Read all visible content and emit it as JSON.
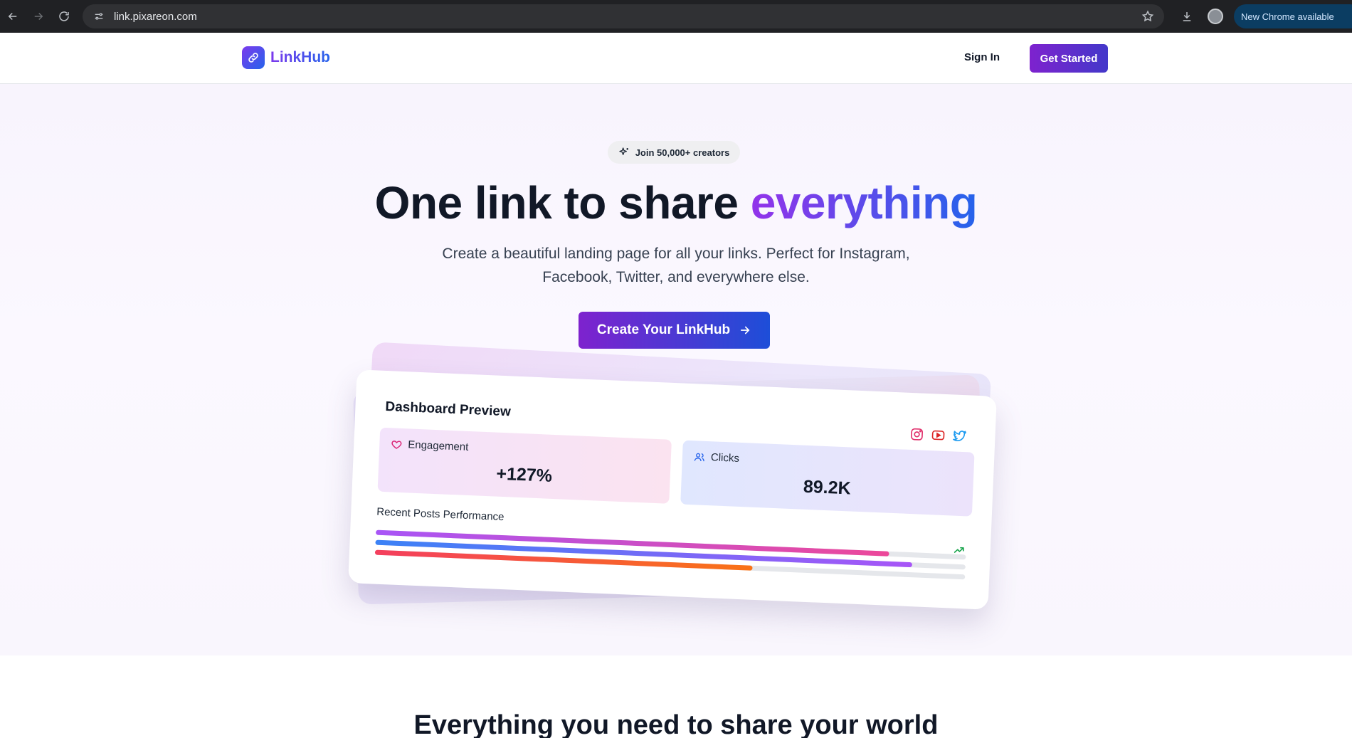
{
  "browser": {
    "url": "link.pixareon.com",
    "update_label": "New Chrome available"
  },
  "header": {
    "brand": "LinkHub",
    "signin_label": "Sign In",
    "get_started_label": "Get Started"
  },
  "hero": {
    "badge_text": "Join 50,000+ creators",
    "headline_main": "One link to share ",
    "headline_accent": "everything",
    "subtext_line1": "Create a beautiful landing page for all your links. Perfect for Instagram,",
    "subtext_line2": "Facebook, Twitter, and everywhere else.",
    "cta_label": "Create Your LinkHub"
  },
  "dashboard": {
    "title": "Dashboard Preview",
    "engagement_label": "Engagement",
    "engagement_value": "+127%",
    "clicks_label": "Clicks",
    "clicks_value": "89.2K",
    "recent_label": "Recent Posts Performance",
    "bars": [
      {
        "fill": 0.87,
        "from": "#a855f7",
        "to": "#ec4899"
      },
      {
        "fill": 0.91,
        "from": "#3b82f6",
        "to": "#a855f7"
      },
      {
        "fill": 0.64,
        "from": "#f43f5e",
        "to": "#f97316"
      }
    ],
    "colors": {
      "instagram": "#e1306c",
      "youtube": "#dc2626",
      "twitter": "#1d9bf0",
      "trend": "#16a34a"
    }
  },
  "features": {
    "title": "Everything you need to share your world"
  }
}
